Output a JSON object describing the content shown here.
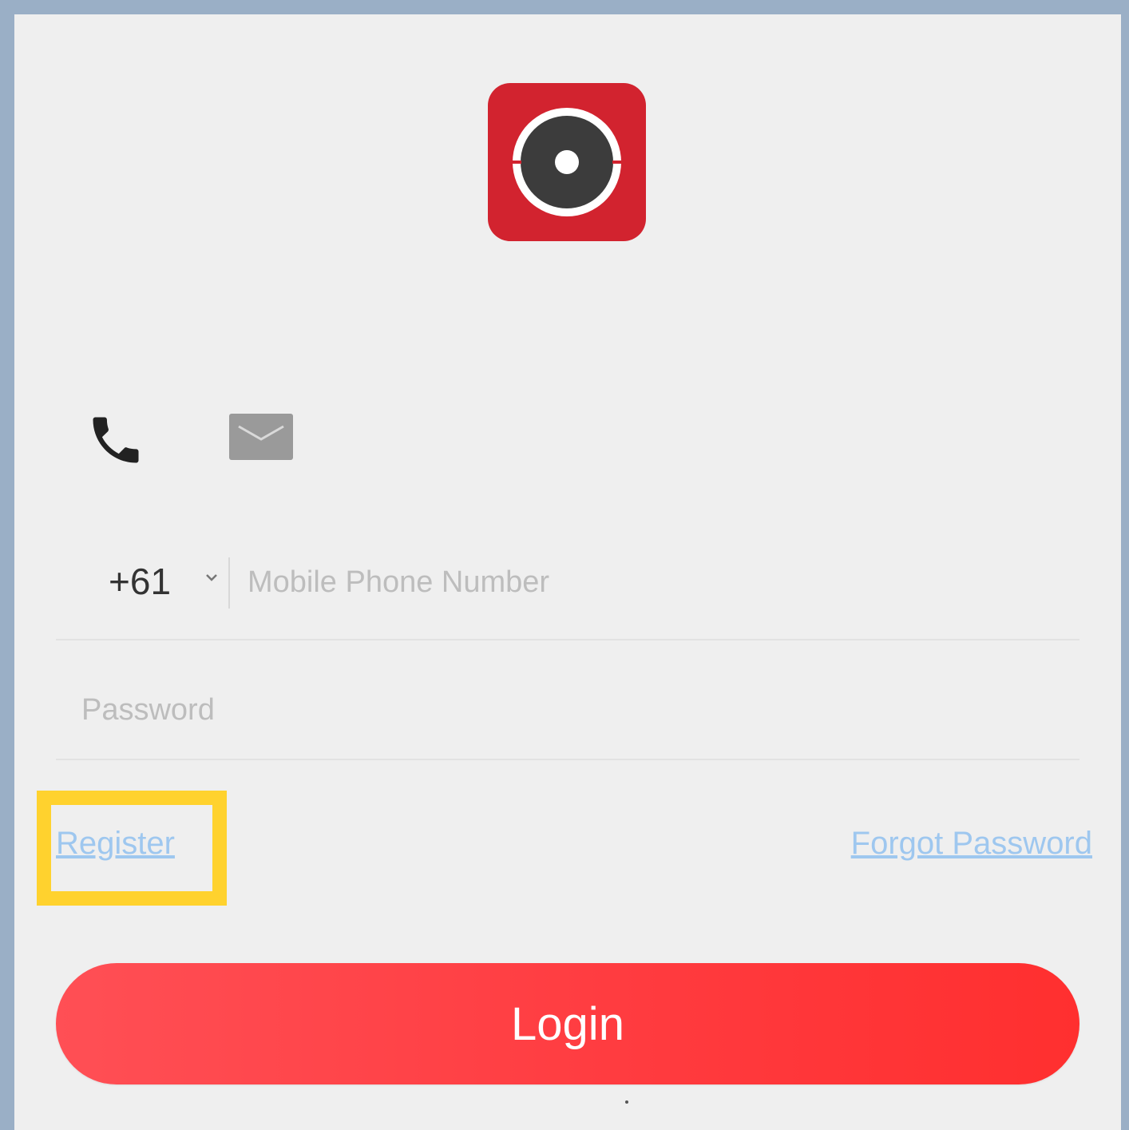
{
  "app": {
    "logo_icon": "camera-lens-logo",
    "accent_color": "#d2232f"
  },
  "tabs": [
    {
      "icon": "phone-icon",
      "active": true
    },
    {
      "icon": "email-icon",
      "active": false
    }
  ],
  "phone_field": {
    "country_code": "+61",
    "placeholder": "Mobile Phone Number",
    "value": ""
  },
  "password_field": {
    "placeholder": "Password",
    "value": ""
  },
  "links": {
    "register": "Register",
    "forgot_password": "Forgot Password"
  },
  "login_button": {
    "label": "Login"
  },
  "highlight": {
    "target": "register",
    "color": "#ffd22e"
  }
}
